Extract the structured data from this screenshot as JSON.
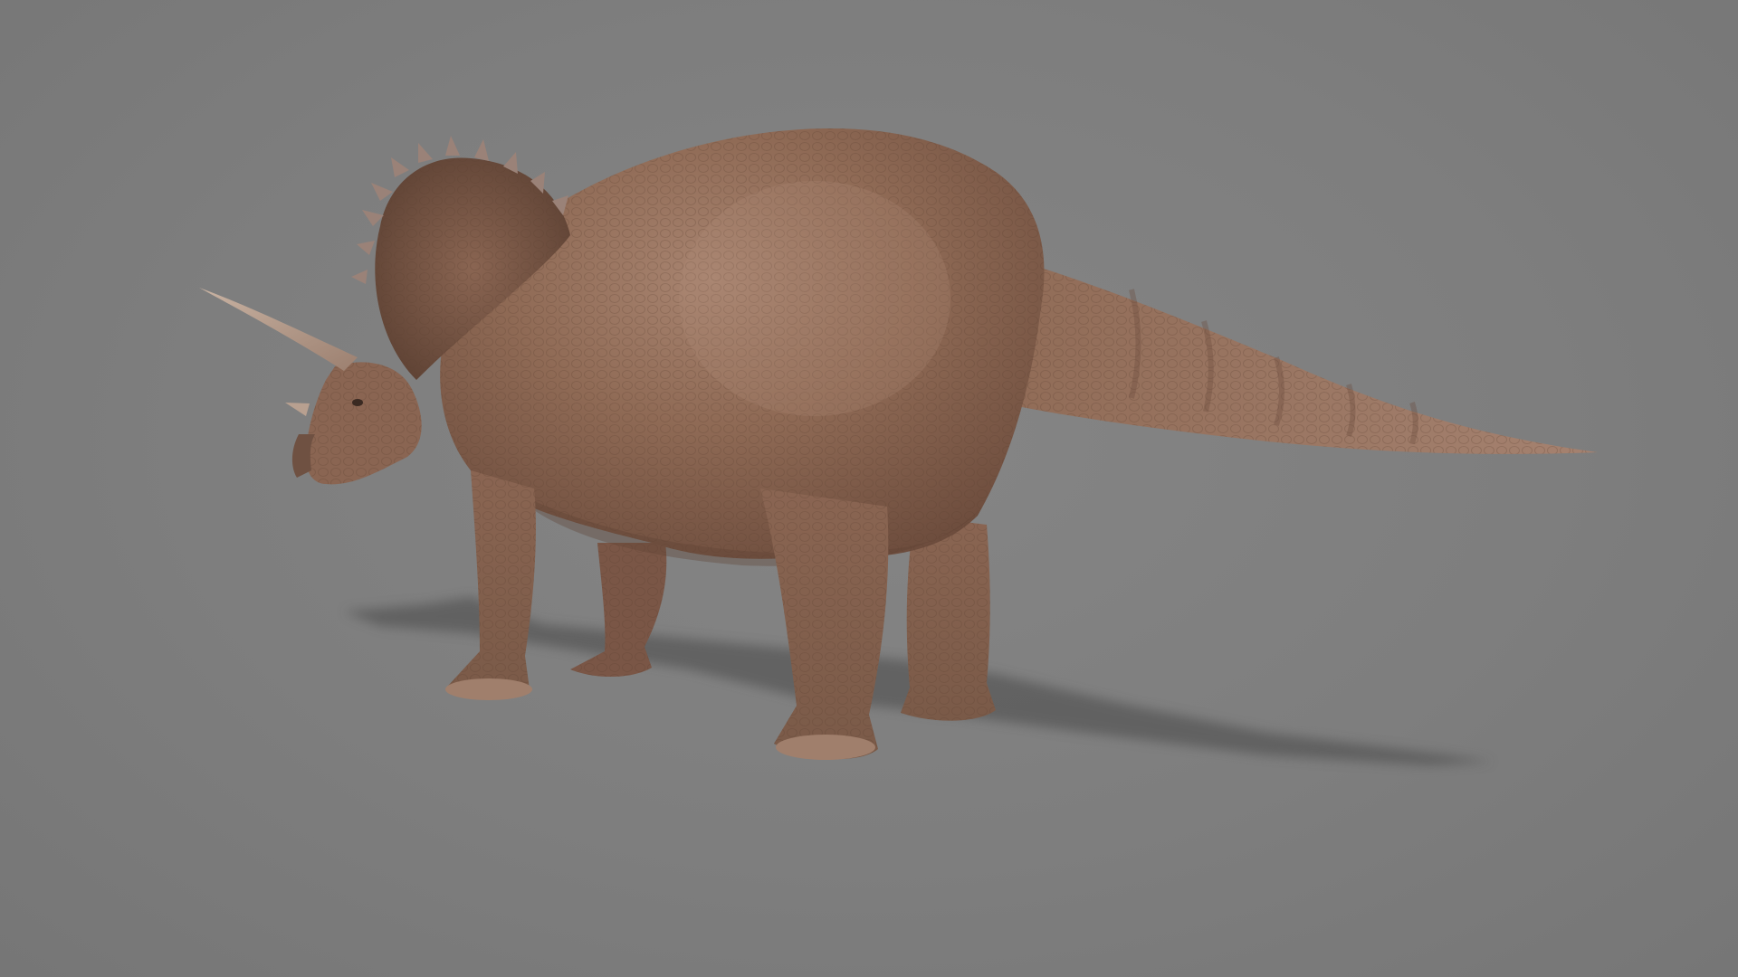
{
  "scene": {
    "subject_icon": "triceratops-icon",
    "colors": {
      "background": "#7d7d7d",
      "shadow": "#555555",
      "skin": "#8a6450",
      "skin_light": "#a47e66",
      "skin_dark": "#6a4a3a",
      "horn": "#b8a090",
      "frill_spike": "#9a8278"
    }
  }
}
